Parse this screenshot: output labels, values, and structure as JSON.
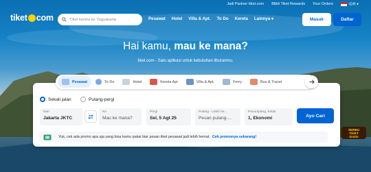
{
  "topbar": {
    "partner": "Jadi Partner tiket.com",
    "rewards": "Blibli Tiket Rewards",
    "orders": "Your Orders",
    "currency": "IDR"
  },
  "header": {
    "logo_left": "tiket",
    "logo_right": "com",
    "search_placeholder": "Tiket kereta ke Yogyakarta",
    "nav": [
      "Pesawat",
      "Hotel",
      "Villa & Apt.",
      "To Do",
      "Kereta",
      "Lainnya"
    ],
    "login": "Masuk",
    "register": "Daftar"
  },
  "hero": {
    "headline_regular": "Hai kamu, ",
    "headline_bold": "mau ke mana?",
    "subtitle": "tiket.com - Satu aplikasi untuk kebutuhan liburanmu."
  },
  "tabs": [
    {
      "label": "Pesawat",
      "icon": "plane-icon",
      "active": true
    },
    {
      "label": "To Do",
      "icon": "ticket-icon",
      "active": false
    },
    {
      "label": "Hotel",
      "icon": "hotel-icon",
      "active": false
    },
    {
      "label": "Kereta Api",
      "icon": "train-icon",
      "active": false
    },
    {
      "label": "Villa & Apt.",
      "icon": "villa-icon",
      "active": false
    },
    {
      "label": "Ferry",
      "icon": "ferry-icon",
      "active": false
    },
    {
      "label": "Bus & Travel",
      "icon": "bus-icon",
      "active": false
    }
  ],
  "trip_type": {
    "one_way": "Sekali jalan",
    "round_trip": "Pulang-pergi",
    "selected": "one_way"
  },
  "fields": {
    "from_label": "Dari",
    "from_value": "Jakarta JKTC",
    "to_label": "Ke",
    "to_placeholder": "Mau ke mana?",
    "depart_label": "Pergi",
    "depart_value": "Sel, 5 Agt 25",
    "return_label": "Pulang - Lebih he...",
    "return_value": "Pesan pulang-...",
    "passenger_label": "Penumpang, Kelas",
    "passenger_value": "1, Ekonomi"
  },
  "search_button": "Ayo Cari",
  "promo": {
    "text": "Yuk, cek ada promo apa aja yang bisa kamu pakai biar pesan tiket pesawat jadi lebih hemat.",
    "link": "Cek promonya sekarang!"
  },
  "badge": {
    "line1": "SERBU",
    "line2": "TIKET",
    "line3": "Gratis"
  },
  "colors": {
    "primary": "#0064d2",
    "logo_dot": "#ffd200",
    "sky": "#1583c6"
  }
}
